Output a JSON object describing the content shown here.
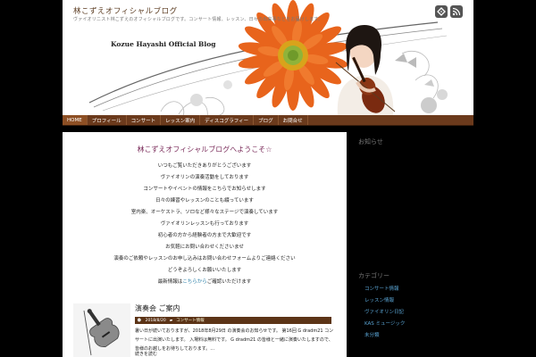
{
  "header": {
    "site_title": "林こずえオフィシャルブログ",
    "description": "ヴァイオリニスト林こずえのオフィシャルブログです。コンサート情報、レッスン、日々の出来事などをお届けします。",
    "brand": "Kozue Hayashi Official Blog",
    "icons": [
      "feedly-icon",
      "rss-icon"
    ],
    "colors": {
      "flower": "#e8641c",
      "flower_center": "#8fb33a"
    }
  },
  "nav": {
    "items": [
      "HOME",
      "プロフィール",
      "コンサート",
      "レッスン案内",
      "ディスコグラフィー",
      "ブログ",
      "お問合せ"
    ]
  },
  "intro": {
    "title": "林こずえオフィシャルブログへようこそ☆",
    "lines": [
      "いつもご覧いただきありがとうございます",
      "ヴァイオリンの演奏活動をしております",
      "コンサートやイベントの情報をこちらでお知らせします",
      "日々の練習やレッスンのことも綴っています",
      "室内楽、オーケストラ、ソロなど様々なステージで演奏しています",
      "ヴァイオリンレッスンも行っております",
      "初心者の方から経験者の方まで大歓迎です",
      "お気軽にお問い合わせくださいませ",
      "演奏のご依頼やレッスンのお申し込みはお問い合わせフォームよりご連絡ください",
      "どうぞよろしくお願いいたします"
    ],
    "last_prefix": "最新情報は",
    "last_link": "こちらから",
    "last_suffix": "ご確認いただけます"
  },
  "post": {
    "title": "演奏会 ご案内",
    "date": "2018/8/20",
    "category": "コンサート情報",
    "excerpt": "暑い日が続いておりますが、2018年8月29日 の演奏会のお知らせです。 第16回 G dradm21 コンサートに出演いたします。 入場料は無料です。 G dradm21 の皆様と一緒に演奏いたしますので、皆様のお越しをお待ちしております。…",
    "more": "続きを読む"
  },
  "sidebar": {
    "title_1": "お知らせ",
    "title_2": "カテゴリー",
    "categories": [
      "コンサート情報",
      "レッスン情報",
      "ヴァイオリン日記",
      "KAS ミュージック",
      "未分類"
    ]
  }
}
